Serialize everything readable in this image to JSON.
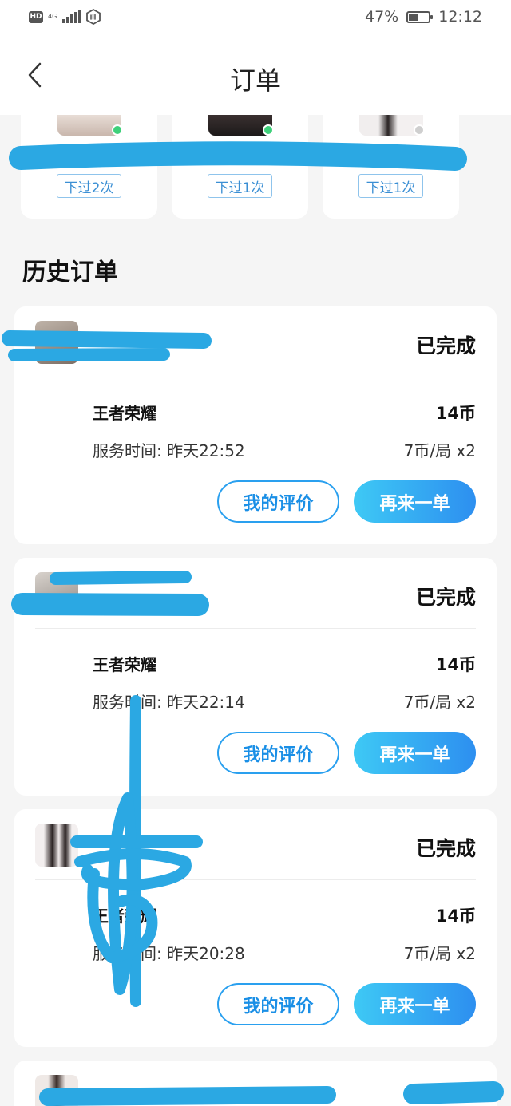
{
  "status_bar": {
    "network_badge": "HD",
    "signal_label": "4G",
    "battery_percent": "47%",
    "battery_level": 0.47,
    "time": "12:12"
  },
  "nav": {
    "title": "订单",
    "back_icon": "chevron-left-icon"
  },
  "frequent": [
    {
      "tag": "下过2次",
      "online": true,
      "dot_color": "#3ed07a"
    },
    {
      "tag": "下过1次",
      "online": true,
      "dot_color": "#3ed07a"
    },
    {
      "tag": "下过1次",
      "online": false,
      "dot_color": "#cfcfcf"
    }
  ],
  "history": {
    "title": "历史订单",
    "orders": [
      {
        "status": "已完成",
        "game": "王者荣耀",
        "total": "14币",
        "time_label": "服务时间:",
        "time_value": "昨天22:52",
        "price": "7币/局 x2",
        "review_label": "我的评价",
        "again_label": "再来一单"
      },
      {
        "status": "已完成",
        "game": "王者荣耀",
        "total": "14币",
        "time_label": "服务时间:",
        "time_value": "昨天22:14",
        "price": "7币/局 x2",
        "review_label": "我的评价",
        "again_label": "再来一单"
      },
      {
        "status": "已完成",
        "game": "王者荣耀",
        "total": "14币",
        "time_label": "服务时间:",
        "time_value": "昨天20:28",
        "price": "7币/局 x2",
        "review_label": "我的评价",
        "again_label": "再来一单"
      }
    ]
  },
  "colors": {
    "accent": "#2aa0ef",
    "scribble": "#2ba8e3"
  }
}
